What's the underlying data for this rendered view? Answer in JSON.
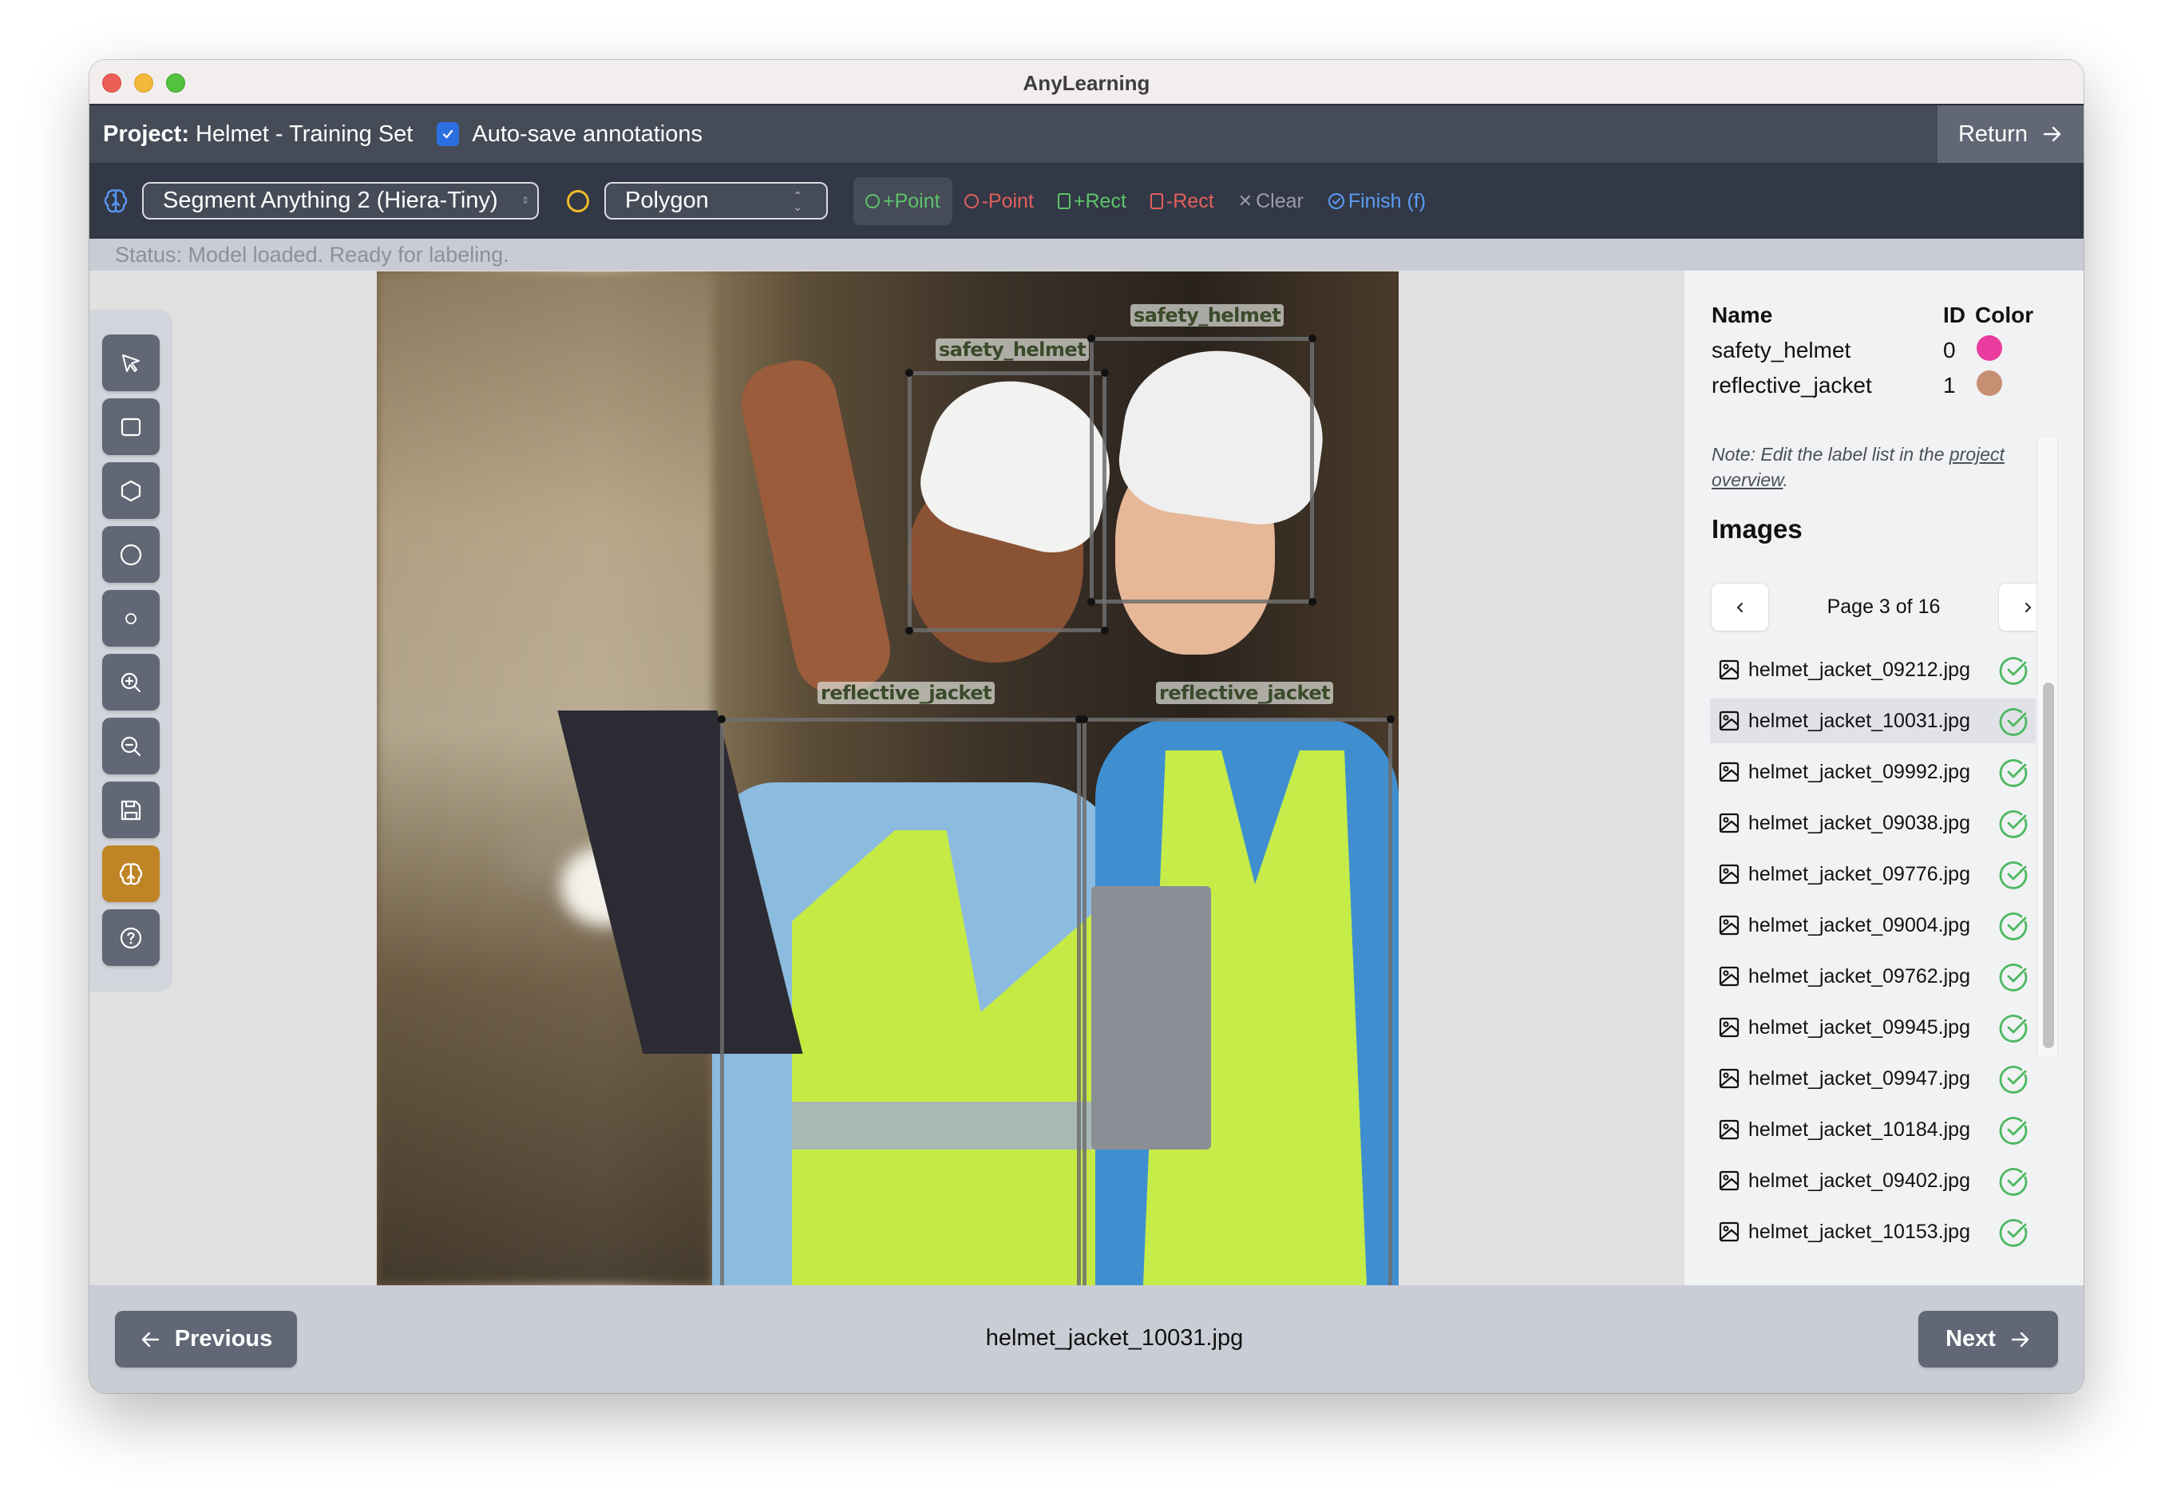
{
  "window": {
    "title": "AnyLearning"
  },
  "header": {
    "project_label": "Project:",
    "project_name": "Helmet  - Training Set",
    "autosave_checked": true,
    "autosave_label": "Auto-save annotations",
    "return_label": "Return"
  },
  "toolbar": {
    "model_icon": "brain-icon",
    "model_select_value": "Segment Anything 2 (Hiera-Tiny)",
    "shape_icon": "circle-icon",
    "shape_select_value": "Polygon",
    "sam_buttons": [
      {
        "label": "+Point",
        "icon": "circle-icon",
        "color": "#5dc46a",
        "active": true
      },
      {
        "label": "-Point",
        "icon": "circle-icon",
        "color": "#e3605c",
        "active": false
      },
      {
        "label": "+Rect",
        "icon": "square-icon",
        "color": "#5dc46a",
        "active": false
      },
      {
        "label": "-Rect",
        "icon": "square-icon",
        "color": "#e3605c",
        "active": false
      },
      {
        "label": "Clear",
        "icon": "x-icon",
        "color": "#9a9ea7",
        "active": false
      },
      {
        "label": "Finish (f)",
        "icon": "check-circle-icon",
        "color": "#5a9cf5",
        "active": false
      }
    ]
  },
  "status": {
    "text": "Status: Model loaded. Ready for labeling."
  },
  "tools": [
    {
      "name": "select",
      "icon": "cursor-icon",
      "active": false
    },
    {
      "name": "rectangle",
      "icon": "square-icon",
      "active": false
    },
    {
      "name": "polygon",
      "icon": "hexagon-icon",
      "active": false
    },
    {
      "name": "circle",
      "icon": "circle-icon",
      "active": false
    },
    {
      "name": "point",
      "icon": "small-circle-icon",
      "active": false
    },
    {
      "name": "zoom-in",
      "icon": "zoom-in-icon",
      "active": false
    },
    {
      "name": "zoom-out",
      "icon": "zoom-out-icon",
      "active": false
    },
    {
      "name": "save",
      "icon": "save-icon",
      "active": false
    },
    {
      "name": "ai-assist",
      "icon": "brain-icon",
      "active": true
    },
    {
      "name": "help",
      "icon": "help-icon",
      "active": false
    }
  ],
  "annotations": [
    {
      "label": "safety_helmet"
    },
    {
      "label": "safety_helmet"
    },
    {
      "label": "reflective_jacket"
    },
    {
      "label": "reflective_jacket"
    }
  ],
  "labels": {
    "headers": {
      "name": "Name",
      "id": "ID",
      "color": "Color"
    },
    "rows": [
      {
        "name": "safety_helmet",
        "id": "0",
        "color": "#ea3c9e"
      },
      {
        "name": "reflective_jacket",
        "id": "1",
        "color": "#c68f74"
      }
    ],
    "note_prefix": "Note: Edit the label list in the ",
    "note_link": "project overview",
    "note_suffix": "."
  },
  "images": {
    "heading": "Images",
    "pager_text": "Page 3 of 16",
    "current_page": 3,
    "total_pages": 16,
    "prev_icon": "chevron-left-icon",
    "next_icon": "chevron-right-icon",
    "scroll_position": 0.4,
    "items": [
      {
        "name": "helmet_jacket_09212.jpg",
        "done": true,
        "selected": false
      },
      {
        "name": "helmet_jacket_10031.jpg",
        "done": true,
        "selected": true
      },
      {
        "name": "helmet_jacket_09992.jpg",
        "done": true,
        "selected": false
      },
      {
        "name": "helmet_jacket_09038.jpg",
        "done": true,
        "selected": false
      },
      {
        "name": "helmet_jacket_09776.jpg",
        "done": true,
        "selected": false
      },
      {
        "name": "helmet_jacket_09004.jpg",
        "done": true,
        "selected": false
      },
      {
        "name": "helmet_jacket_09762.jpg",
        "done": true,
        "selected": false
      },
      {
        "name": "helmet_jacket_09945.jpg",
        "done": true,
        "selected": false
      },
      {
        "name": "helmet_jacket_09947.jpg",
        "done": true,
        "selected": false
      },
      {
        "name": "helmet_jacket_10184.jpg",
        "done": true,
        "selected": false
      },
      {
        "name": "helmet_jacket_09402.jpg",
        "done": true,
        "selected": false
      },
      {
        "name": "helmet_jacket_10153.jpg",
        "done": true,
        "selected": false
      }
    ]
  },
  "footer": {
    "previous_label": "Previous",
    "next_label": "Next",
    "current_file": "helmet_jacket_10031.jpg"
  }
}
